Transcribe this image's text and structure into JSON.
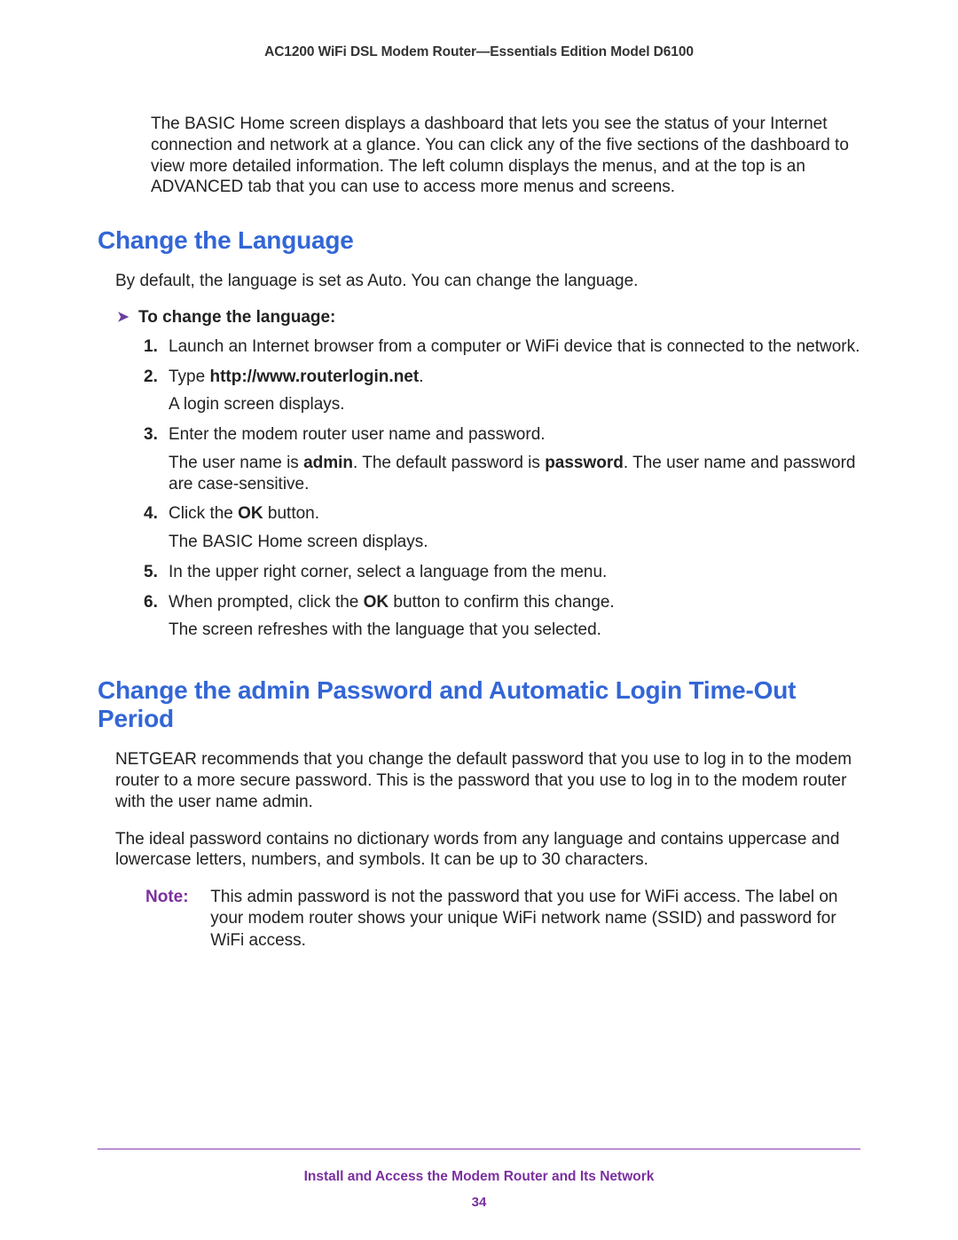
{
  "header": {
    "title": "AC1200 WiFi DSL Modem Router—Essentials Edition Model D6100"
  },
  "intro": "The BASIC Home screen displays a dashboard that lets you see the status of your Internet connection and network at a glance. You can click any of the five sections of the dashboard to view more detailed information. The left column displays the menus, and at the top is an ADVANCED tab that you can use to access more menus and screens.",
  "section1": {
    "heading": "Change the Language",
    "intro": "By default, the language is set as Auto. You can change the language.",
    "task_label": "To change the language:",
    "steps": {
      "s1": "Launch an Internet browser from a computer or WiFi device that is connected to the network.",
      "s2_pre": "Type ",
      "s2_bold": "http://www.routerlogin.net",
      "s2_post": ".",
      "s2_sub": "A login screen displays.",
      "s3": "Enter the modem router user name and password.",
      "s3_sub_a": "The user name is ",
      "s3_sub_b": "admin",
      "s3_sub_c": ". The default password is ",
      "s3_sub_d": "password",
      "s3_sub_e": ". The user name and password are case-sensitive.",
      "s4_pre": "Click the ",
      "s4_bold": "OK",
      "s4_post": " button.",
      "s4_sub": "The BASIC Home screen displays.",
      "s5": "In the upper right corner, select a language from the menu.",
      "s6_pre": "When prompted, click the ",
      "s6_bold": "OK",
      "s6_post": " button to confirm this change.",
      "s6_sub": "The screen refreshes with the language that you selected."
    }
  },
  "section2": {
    "heading": "Change the admin Password and Automatic Login Time-Out Period",
    "p1": "NETGEAR recommends that you change the default password that you use to log in to the modem router to a more secure password. This is the password that you use to log in to the modem router with the user name admin.",
    "p2": "The ideal password contains no dictionary words from any language and contains uppercase and lowercase letters, numbers, and symbols. It can be up to 30 characters.",
    "note_label": "Note:",
    "note_body": "This admin password is not the password that you use for WiFi access. The label on your modem router shows your unique WiFi network name (SSID) and password for WiFi access."
  },
  "footer": {
    "chapter": "Install and Access the Modem Router and Its Network",
    "page": "34"
  }
}
